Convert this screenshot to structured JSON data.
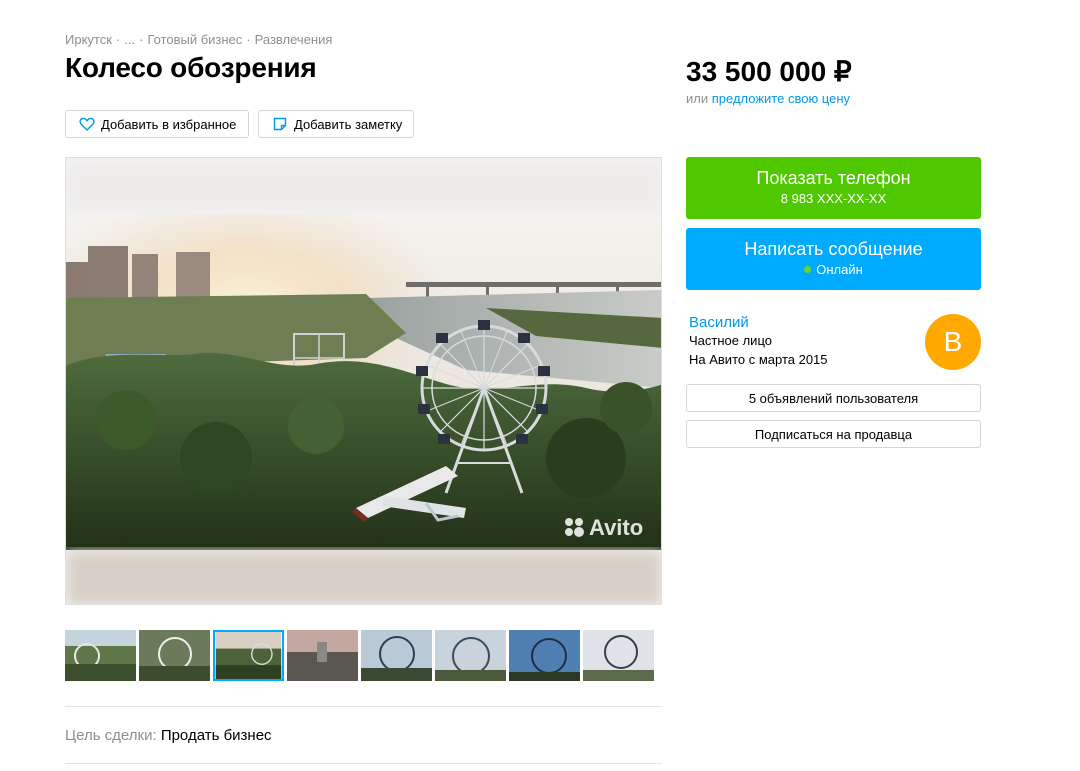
{
  "breadcrumbs": {
    "city": "Иркутск",
    "sep1": "·",
    "ellipsis": "...",
    "sep2": "·",
    "category": "Готовый бизнес",
    "sep3": "·",
    "subcategory": "Развлечения"
  },
  "listing": {
    "title": "Колесо обозрения",
    "price": "33 500 000 ₽",
    "offer_prefix": "или",
    "offer_link": "предложите свою цену"
  },
  "actions": {
    "favorite_label": "Добавить в избранное",
    "note_label": "Добавить заметку"
  },
  "gallery": {
    "watermark": "Avito",
    "thumbnail_count": 8,
    "active_thumbnail": 3
  },
  "contact": {
    "show_phone_label": "Показать телефон",
    "phone_masked": "8 983 XXX-XX-XX",
    "write_message_label": "Написать сообщение",
    "online_status": "Онлайн"
  },
  "seller": {
    "name": "Василий",
    "type": "Частное лицо",
    "since": "На Авито с марта 2015",
    "avatar_letter": "В",
    "listings_button": "5 объявлений пользователя",
    "subscribe_button": "Подписаться на продавца"
  },
  "details": {
    "deal_label": "Цель сделки:",
    "deal_value": "Продать бизнес"
  },
  "colors": {
    "phone_button": "#4fc800",
    "message_button": "#00aaff",
    "link": "#0099e6",
    "avatar": "#ffa800",
    "online": "#65d72a"
  }
}
